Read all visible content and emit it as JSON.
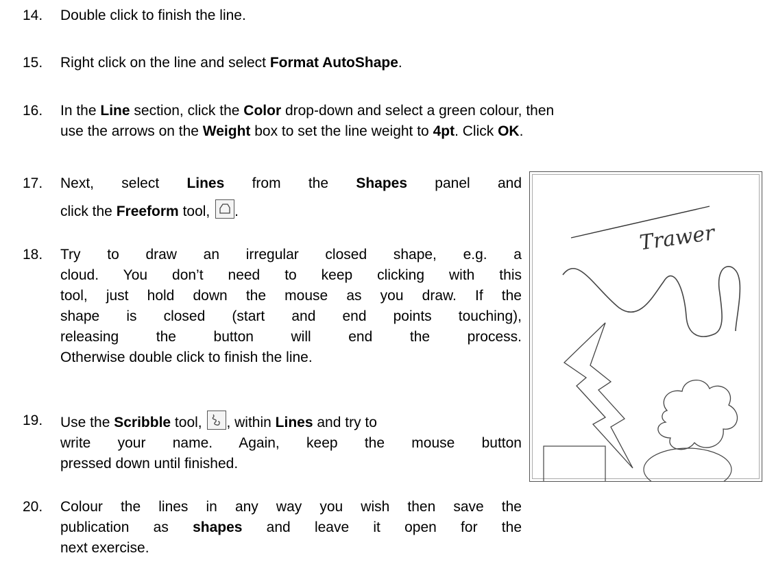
{
  "steps": [
    {
      "num": "14.",
      "parts": [
        [
          "Double click to finish the line.",
          false
        ]
      ]
    },
    {
      "num": "15.",
      "parts": [
        [
          "Right click on the line and select ",
          false
        ],
        [
          "Format AutoShape",
          true
        ],
        [
          ".",
          false
        ]
      ]
    },
    {
      "num": "16.",
      "line1": [
        [
          "In the ",
          false
        ],
        [
          "Line",
          true
        ],
        [
          " section, click the ",
          false
        ],
        [
          "Color",
          true
        ],
        [
          " drop-down and select a green colour, then",
          false
        ]
      ],
      "line2": [
        [
          "use the arrows on the ",
          false
        ],
        [
          "Weight",
          true
        ],
        [
          " box to set the line weight to ",
          false
        ],
        [
          "4pt",
          true
        ],
        [
          ". Click ",
          false
        ],
        [
          "OK",
          true
        ],
        [
          ".",
          false
        ]
      ]
    },
    {
      "num": "17.",
      "line1": [
        [
          "Next, select ",
          false
        ],
        [
          "Lines",
          true
        ],
        [
          " from the ",
          false
        ],
        [
          "Shapes",
          true
        ],
        [
          " panel and",
          false
        ]
      ],
      "line2_pre": [
        [
          "click the ",
          false
        ],
        [
          "Freeform",
          true
        ],
        [
          " tool, ",
          false
        ]
      ],
      "line2_post": "."
    },
    {
      "num": "18.",
      "lines": [
        "Try to draw an irregular closed shape, e.g. a",
        "cloud. You don’t need to keep clicking with this",
        "tool, just hold down the mouse as you draw. If the",
        "shape is closed (start and end points touching),",
        "releasing the button will end the process.",
        "Otherwise double click to finish the line."
      ]
    },
    {
      "num": "19.",
      "line1_pre": [
        [
          "Use the ",
          false
        ],
        [
          "Scribble",
          true
        ],
        [
          " tool, ",
          false
        ]
      ],
      "line1_post": [
        [
          ", within ",
          false
        ],
        [
          "Lines",
          true
        ],
        [
          " and try to",
          false
        ]
      ],
      "lines": [
        "write your name.  Again, keep the mouse button",
        "pressed down until finished."
      ]
    },
    {
      "num": "20.",
      "line1": "Colour the lines in any way you wish then save the",
      "line2": [
        [
          "publication as ",
          false
        ],
        [
          "shapes",
          true
        ],
        [
          " and leave it open for the",
          false
        ]
      ],
      "line3": "next exercise."
    }
  ],
  "icons": {
    "freeform": "freeform-tool-icon",
    "scribble": "scribble-tool-icon"
  },
  "figure": {
    "handwriting": "Trawer"
  }
}
